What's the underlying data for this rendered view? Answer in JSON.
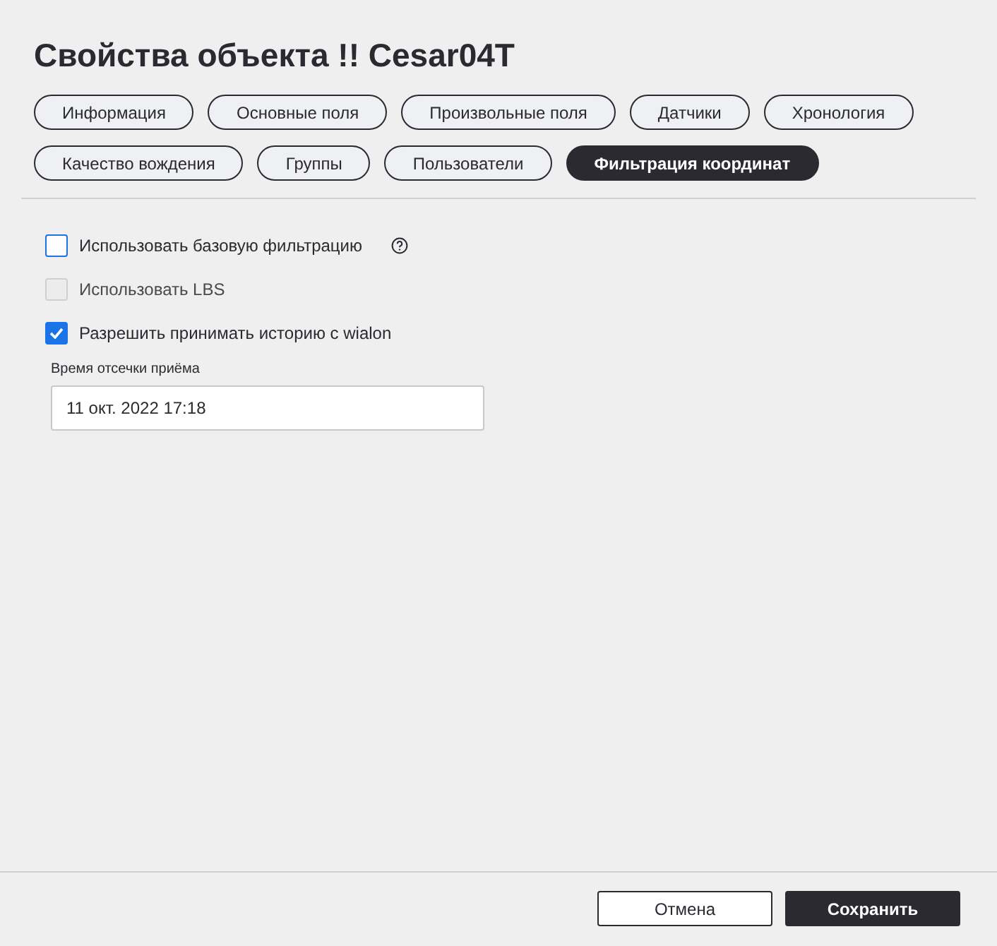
{
  "title": "Свойства объекта !! Cesar04T",
  "tabs": [
    {
      "label": "Информация",
      "selected": false
    },
    {
      "label": "Основные поля",
      "selected": false
    },
    {
      "label": "Произвольные поля",
      "selected": false
    },
    {
      "label": "Датчики",
      "selected": false
    },
    {
      "label": "Хронология",
      "selected": false
    },
    {
      "label": "Качество вождения",
      "selected": false
    },
    {
      "label": "Группы",
      "selected": false
    },
    {
      "label": "Пользователи",
      "selected": false
    },
    {
      "label": "Фильтрация координат",
      "selected": true
    }
  ],
  "options": [
    {
      "kind": "with_help",
      "label": "Использовать базовую фильтрацию",
      "checked": false,
      "disabled": false
    },
    {
      "kind": "plain",
      "label": "Использовать LBS",
      "checked": false,
      "disabled": true
    },
    {
      "kind": "plain",
      "label": "Разрешить принимать историю с wialon",
      "checked": true,
      "disabled": false
    }
  ],
  "cutoff_field": {
    "label": "Время отсечки приёма",
    "value": "11 окт. 2022 17:18"
  },
  "buttons": [
    {
      "label": "Отмена",
      "kind": "secondary"
    },
    {
      "label": "Сохранить",
      "kind": "primary"
    }
  ]
}
